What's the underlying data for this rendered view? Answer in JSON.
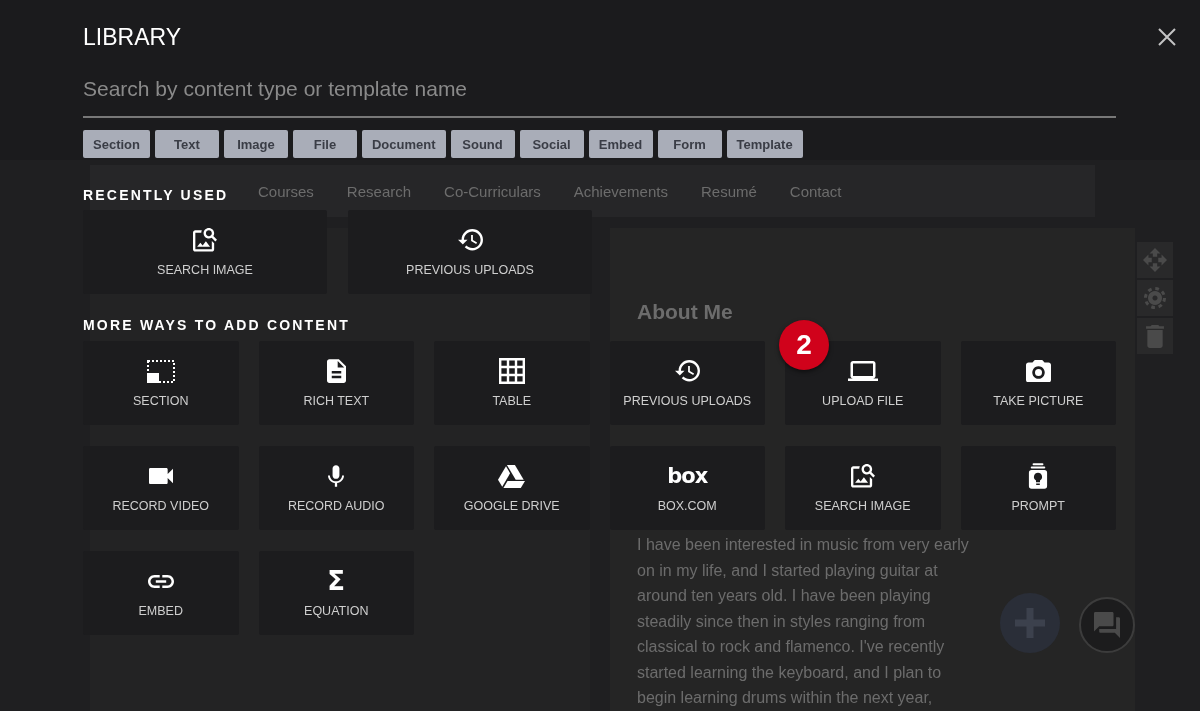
{
  "library": {
    "title": "LIBRARY",
    "search": {
      "placeholder": "Search by content type or template name"
    },
    "filters": [
      "Section",
      "Text",
      "Image",
      "File",
      "Document",
      "Sound",
      "Social",
      "Embed",
      "Form",
      "Template"
    ],
    "sections": [
      {
        "heading": "RECENTLY USED",
        "kind": "wide",
        "tiles": [
          {
            "kind": "imagesearch",
            "label": "SEARCH IMAGE"
          },
          {
            "kind": "history",
            "label": "PREVIOUS UPLOADS"
          }
        ]
      },
      {
        "heading": "MORE WAYS TO ADD CONTENT",
        "kind": "grid",
        "tiles": [
          {
            "kind": "section",
            "label": "SECTION"
          },
          {
            "kind": "document",
            "label": "RICH TEXT"
          },
          {
            "kind": "table",
            "label": "TABLE"
          },
          {
            "kind": "history",
            "label": "PREVIOUS UPLOADS"
          },
          {
            "kind": "laptop",
            "label": "UPLOAD FILE",
            "badge": "2"
          },
          {
            "kind": "camera",
            "label": "TAKE PICTURE"
          },
          {
            "kind": "video",
            "label": "RECORD VIDEO"
          },
          {
            "kind": "microphone",
            "label": "RECORD AUDIO"
          },
          {
            "kind": "drive",
            "label": "GOOGLE DRIVE"
          },
          {
            "kind": "logo",
            "logo": "box",
            "label": "BOX.COM"
          },
          {
            "kind": "imagesearch",
            "label": "SEARCH IMAGE"
          },
          {
            "kind": "prompt",
            "label": "PROMPT"
          },
          {
            "kind": "link",
            "label": "EMBED"
          },
          {
            "kind": "symbol",
            "symbol": "Σ",
            "label": "EQUATION"
          }
        ]
      }
    ]
  },
  "backdrop": {
    "nav": [
      "Courses",
      "Research",
      "Co-Curriculars",
      "Achievements",
      "Resumé",
      "Contact"
    ],
    "heading": "About Me",
    "paragraph": "I have been interested in music from very early\non in my life, and I started playing guitar at\naround ten years old. I have been playing\nsteadily since then in styles ranging from\nclassical to rock and flamenco. I've recently\nstarted learning the keyboard, and I plan to\nbegin learning drums within the next year,"
  }
}
